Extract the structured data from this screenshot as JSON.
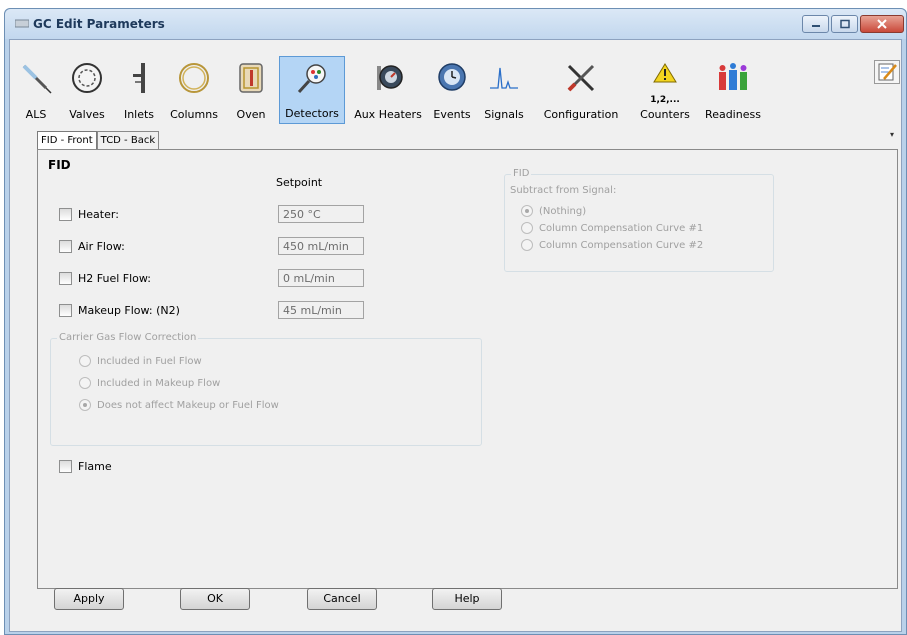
{
  "window": {
    "title": "GC Edit Parameters"
  },
  "toolbar": {
    "items": [
      {
        "label": "ALS",
        "icon": "syringe-icon"
      },
      {
        "label": "Valves",
        "icon": "valve-icon"
      },
      {
        "label": "Inlets",
        "icon": "inlet-icon"
      },
      {
        "label": "Columns",
        "icon": "column-coil-icon"
      },
      {
        "label": "Oven",
        "icon": "oven-icon"
      },
      {
        "label": "Detectors",
        "icon": "detector-icon",
        "active": true
      },
      {
        "label": "Aux Heaters",
        "icon": "gauge-icon"
      },
      {
        "label": "Events",
        "icon": "events-icon"
      },
      {
        "label": "Signals",
        "icon": "signal-peak-icon"
      },
      {
        "label": "Configuration",
        "icon": "tools-icon"
      },
      {
        "label": "Counters",
        "icon": "warning-counter-icon",
        "sublabel": "1,2,..."
      },
      {
        "label": "Readiness",
        "icon": "readiness-icon"
      }
    ]
  },
  "tabs": [
    {
      "label": "FID - Front",
      "active": true
    },
    {
      "label": "TCD - Back",
      "active": false
    }
  ],
  "panel": {
    "title": "FID",
    "setpoint_header": "Setpoint",
    "rows": [
      {
        "label": "Heater:",
        "value": "250 °C"
      },
      {
        "label": "Air Flow:",
        "value": "450 mL/min"
      },
      {
        "label": "H2 Fuel Flow:",
        "value": "0 mL/min"
      },
      {
        "label": "Makeup Flow: (N2)",
        "value": "45 mL/min"
      }
    ],
    "carrier_group": {
      "title": "Carrier Gas Flow Correction",
      "options": [
        {
          "label": "Included in Fuel Flow",
          "selected": false
        },
        {
          "label": "Included in Makeup Flow",
          "selected": false
        },
        {
          "label": "Does not affect Makeup or Fuel Flow",
          "selected": true
        }
      ]
    },
    "flame_label": "Flame",
    "fid_group": {
      "title": "FID",
      "subtitle": "Subtract from Signal:",
      "options": [
        {
          "label": "(Nothing)",
          "selected": true
        },
        {
          "label": "Column Compensation Curve #1",
          "selected": false
        },
        {
          "label": "Column Compensation Curve #2",
          "selected": false
        }
      ]
    }
  },
  "buttons": {
    "apply": "Apply",
    "ok": "OK",
    "cancel": "Cancel",
    "help": "Help"
  }
}
